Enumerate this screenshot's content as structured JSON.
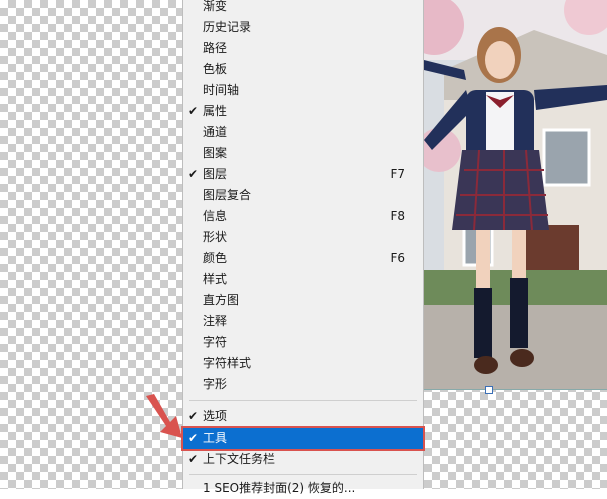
{
  "menu": {
    "items": [
      {
        "label": "渐变",
        "checked": false,
        "shortcut": ""
      },
      {
        "label": "历史记录",
        "checked": false,
        "shortcut": ""
      },
      {
        "label": "路径",
        "checked": false,
        "shortcut": ""
      },
      {
        "label": "色板",
        "checked": false,
        "shortcut": ""
      },
      {
        "label": "时间轴",
        "checked": false,
        "shortcut": ""
      },
      {
        "label": "属性",
        "checked": true,
        "shortcut": ""
      },
      {
        "label": "通道",
        "checked": false,
        "shortcut": ""
      },
      {
        "label": "图案",
        "checked": false,
        "shortcut": ""
      },
      {
        "label": "图层",
        "checked": true,
        "shortcut": "F7"
      },
      {
        "label": "图层复合",
        "checked": false,
        "shortcut": ""
      },
      {
        "label": "信息",
        "checked": false,
        "shortcut": "F8"
      },
      {
        "label": "形状",
        "checked": false,
        "shortcut": ""
      },
      {
        "label": "颜色",
        "checked": false,
        "shortcut": "F6"
      },
      {
        "label": "样式",
        "checked": false,
        "shortcut": ""
      },
      {
        "label": "直方图",
        "checked": false,
        "shortcut": ""
      },
      {
        "label": "注释",
        "checked": false,
        "shortcut": ""
      },
      {
        "label": "字符",
        "checked": false,
        "shortcut": ""
      },
      {
        "label": "字符样式",
        "checked": false,
        "shortcut": ""
      },
      {
        "label": "字形",
        "checked": false,
        "shortcut": ""
      }
    ],
    "options_items": [
      {
        "label": "选项",
        "checked": true
      },
      {
        "label": "工具",
        "checked": true,
        "highlighted": true
      },
      {
        "label": "上下文任务栏",
        "checked": true
      }
    ],
    "recent_file": "1 SEO推荐封面(2) 恢复的...",
    "check_glyph": "✔"
  },
  "colors": {
    "menu_bg": "#f0f0f0",
    "highlight": "#0c6fd0",
    "annotation_red": "#d9534f"
  }
}
